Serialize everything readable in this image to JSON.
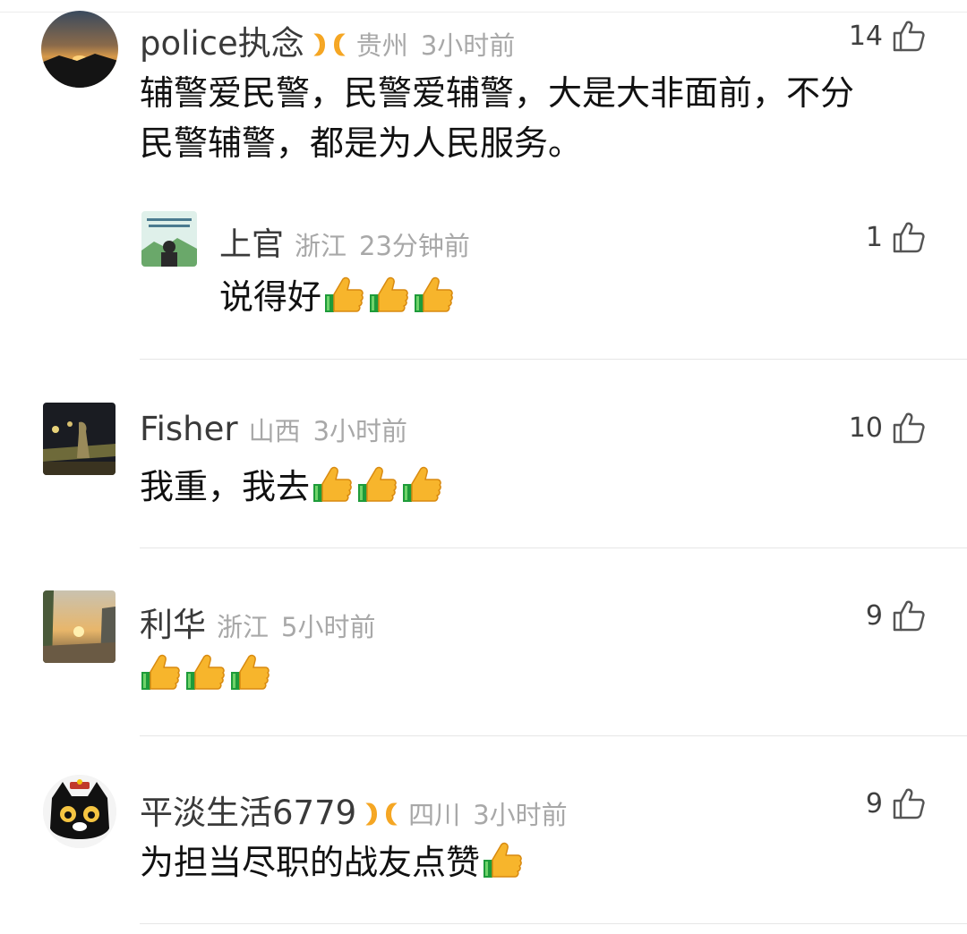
{
  "comments": [
    {
      "username": "police执念",
      "region": "贵州",
      "time": "3小时前",
      "likes": "14",
      "content_lines": [
        "辅警爱民警，民警爱辅警，大是大非面前，不分",
        "民警辅警，都是为人民服务。"
      ],
      "emoji_count": 0,
      "badge": "vip-badge-icon",
      "reply": {
        "username": "上官",
        "region": "浙江",
        "time": "23分钟前",
        "likes": "1",
        "text": "说得好",
        "emoji_count": 3
      }
    },
    {
      "username": "Fisher",
      "region": "山西",
      "time": "3小时前",
      "likes": "10",
      "text": "我重，我去",
      "emoji_count": 3
    },
    {
      "username": "利华",
      "region": "浙江",
      "time": "5小时前",
      "likes": "9",
      "text": "",
      "emoji_count": 3
    },
    {
      "username": "平淡生活6779",
      "region": "四川",
      "time": "3小时前",
      "likes": "9",
      "text": "为担当尽职的战友点赞",
      "emoji_count": 1,
      "badge": "vip-badge-icon"
    }
  ],
  "icons": {
    "like": "thumbs-up-outline-icon",
    "emoji": "thumbs-up-emoji"
  },
  "colors": {
    "username": "#3a3a3a",
    "meta": "#a8a8a8",
    "badge": "#f5a623",
    "divider": "#e6e6e6"
  }
}
